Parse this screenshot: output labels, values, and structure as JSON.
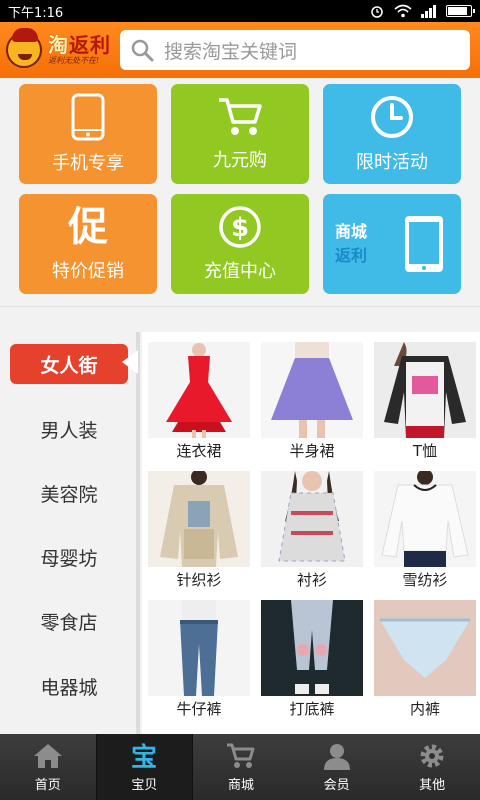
{
  "status_bar": {
    "time": "下午1:16"
  },
  "header": {
    "logo_char": "淘",
    "logo_name": "返利",
    "logo_slogan": "返利无处不在!",
    "search_placeholder": "搜索淘宝关键词"
  },
  "tiles": [
    {
      "label": "手机专享",
      "icon": "phone-icon",
      "color": "#f69331"
    },
    {
      "label": "九元购",
      "icon": "cart-icon",
      "color": "#92c822"
    },
    {
      "label": "限时活动",
      "icon": "clock-icon",
      "color": "#40bbe8"
    },
    {
      "label": "特价促销",
      "icon": "promo-char-icon",
      "char": "促",
      "color": "#f69331"
    },
    {
      "label": "充值中心",
      "icon": "dollar-icon",
      "color": "#92c822"
    },
    {
      "label_line1": "商城",
      "label_line2": "返利",
      "icon": "tablet-icon",
      "color": "#40bbe8"
    }
  ],
  "categories": [
    {
      "label": "女人街",
      "active": true
    },
    {
      "label": "男人装"
    },
    {
      "label": "美容院"
    },
    {
      "label": "母婴坊"
    },
    {
      "label": "零食店"
    },
    {
      "label": "电器城"
    }
  ],
  "products": [
    {
      "label": "连衣裙"
    },
    {
      "label": "半身裙"
    },
    {
      "label": "T恤"
    },
    {
      "label": "针织衫"
    },
    {
      "label": "衬衫"
    },
    {
      "label": "雪纺衫"
    },
    {
      "label": "牛仔裤"
    },
    {
      "label": "打底裤"
    },
    {
      "label": "内裤"
    }
  ],
  "bottom_nav": [
    {
      "label": "首页",
      "icon": "home-icon"
    },
    {
      "label": "宝贝",
      "icon": "bao-icon",
      "active": true
    },
    {
      "label": "商城",
      "icon": "cart-icon"
    },
    {
      "label": "会员",
      "icon": "user-icon"
    },
    {
      "label": "其他",
      "icon": "gear-icon"
    }
  ],
  "colors": {
    "header_orange": "#f56f07",
    "tile_orange": "#f69331",
    "tile_green": "#92c822",
    "tile_blue": "#40bbe8",
    "active_category": "#e6412c"
  }
}
